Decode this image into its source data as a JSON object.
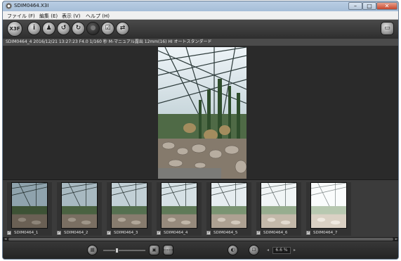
{
  "window": {
    "title": "SDIM0464.X3I"
  },
  "window_controls": {
    "minimize": "–",
    "maximize": "□",
    "close": "✕"
  },
  "menu": [
    {
      "label": "ファイル (F)"
    },
    {
      "label": "編集 (E)"
    },
    {
      "label": "表示 (V)"
    },
    {
      "label": "ヘルプ (H)"
    }
  ],
  "toolbar": {
    "buttons": [
      {
        "icon": "x3f-icon",
        "glyph": "X3F"
      },
      {
        "icon": "info-icon",
        "glyph": "i"
      },
      {
        "icon": "stamp-icon",
        "glyph": "♟"
      },
      {
        "icon": "rotate-left-icon",
        "glyph": "↺"
      },
      {
        "icon": "rotate-right-icon",
        "glyph": "↻"
      },
      {
        "icon": "disabled-icon",
        "glyph": "●"
      },
      {
        "icon": "check-icon",
        "glyph": "☑"
      },
      {
        "icon": "compare-icon",
        "glyph": "⇄"
      }
    ],
    "right_button": {
      "icon": "panel-icon",
      "glyph": "▭"
    }
  },
  "info_line": "SDIM0464_4  2016/12/21 13:27:23  F4.0  1/160 秒  M-マニュアル露出  12mm(16)  HI  オートスタンダード",
  "thumbnails": [
    {
      "label": "SDIM0464_1",
      "checked": "✓",
      "brightness": 0.7
    },
    {
      "label": "SDIM0464_2",
      "checked": "✓",
      "brightness": 0.85
    },
    {
      "label": "SDIM0464_3",
      "checked": "✓",
      "brightness": 1.0
    },
    {
      "label": "SDIM0464_4",
      "checked": "✓",
      "brightness": 1.15
    },
    {
      "label": "SDIM0464_5",
      "checked": "✓",
      "brightness": 1.35
    },
    {
      "label": "SDIM0464_6",
      "checked": "✓",
      "brightness": 1.55
    },
    {
      "label": "SDIM0464_7",
      "checked": "✓",
      "brightness": 1.8
    }
  ],
  "scroll": {
    "left": "◄",
    "right": "►"
  },
  "bottom": {
    "grid_glyph": "▦",
    "single_glyph": "▣",
    "dual_glyph": "▭▭",
    "exposure_glyph": "◐",
    "fit_glyph": "⊡",
    "zoom_prev": "◂",
    "zoom_next": "▸",
    "zoom": "6.6 %"
  },
  "colors": {
    "background": "#2a2a2a",
    "titlebar": "#b9cde3",
    "strip": "#3b3b3b"
  }
}
